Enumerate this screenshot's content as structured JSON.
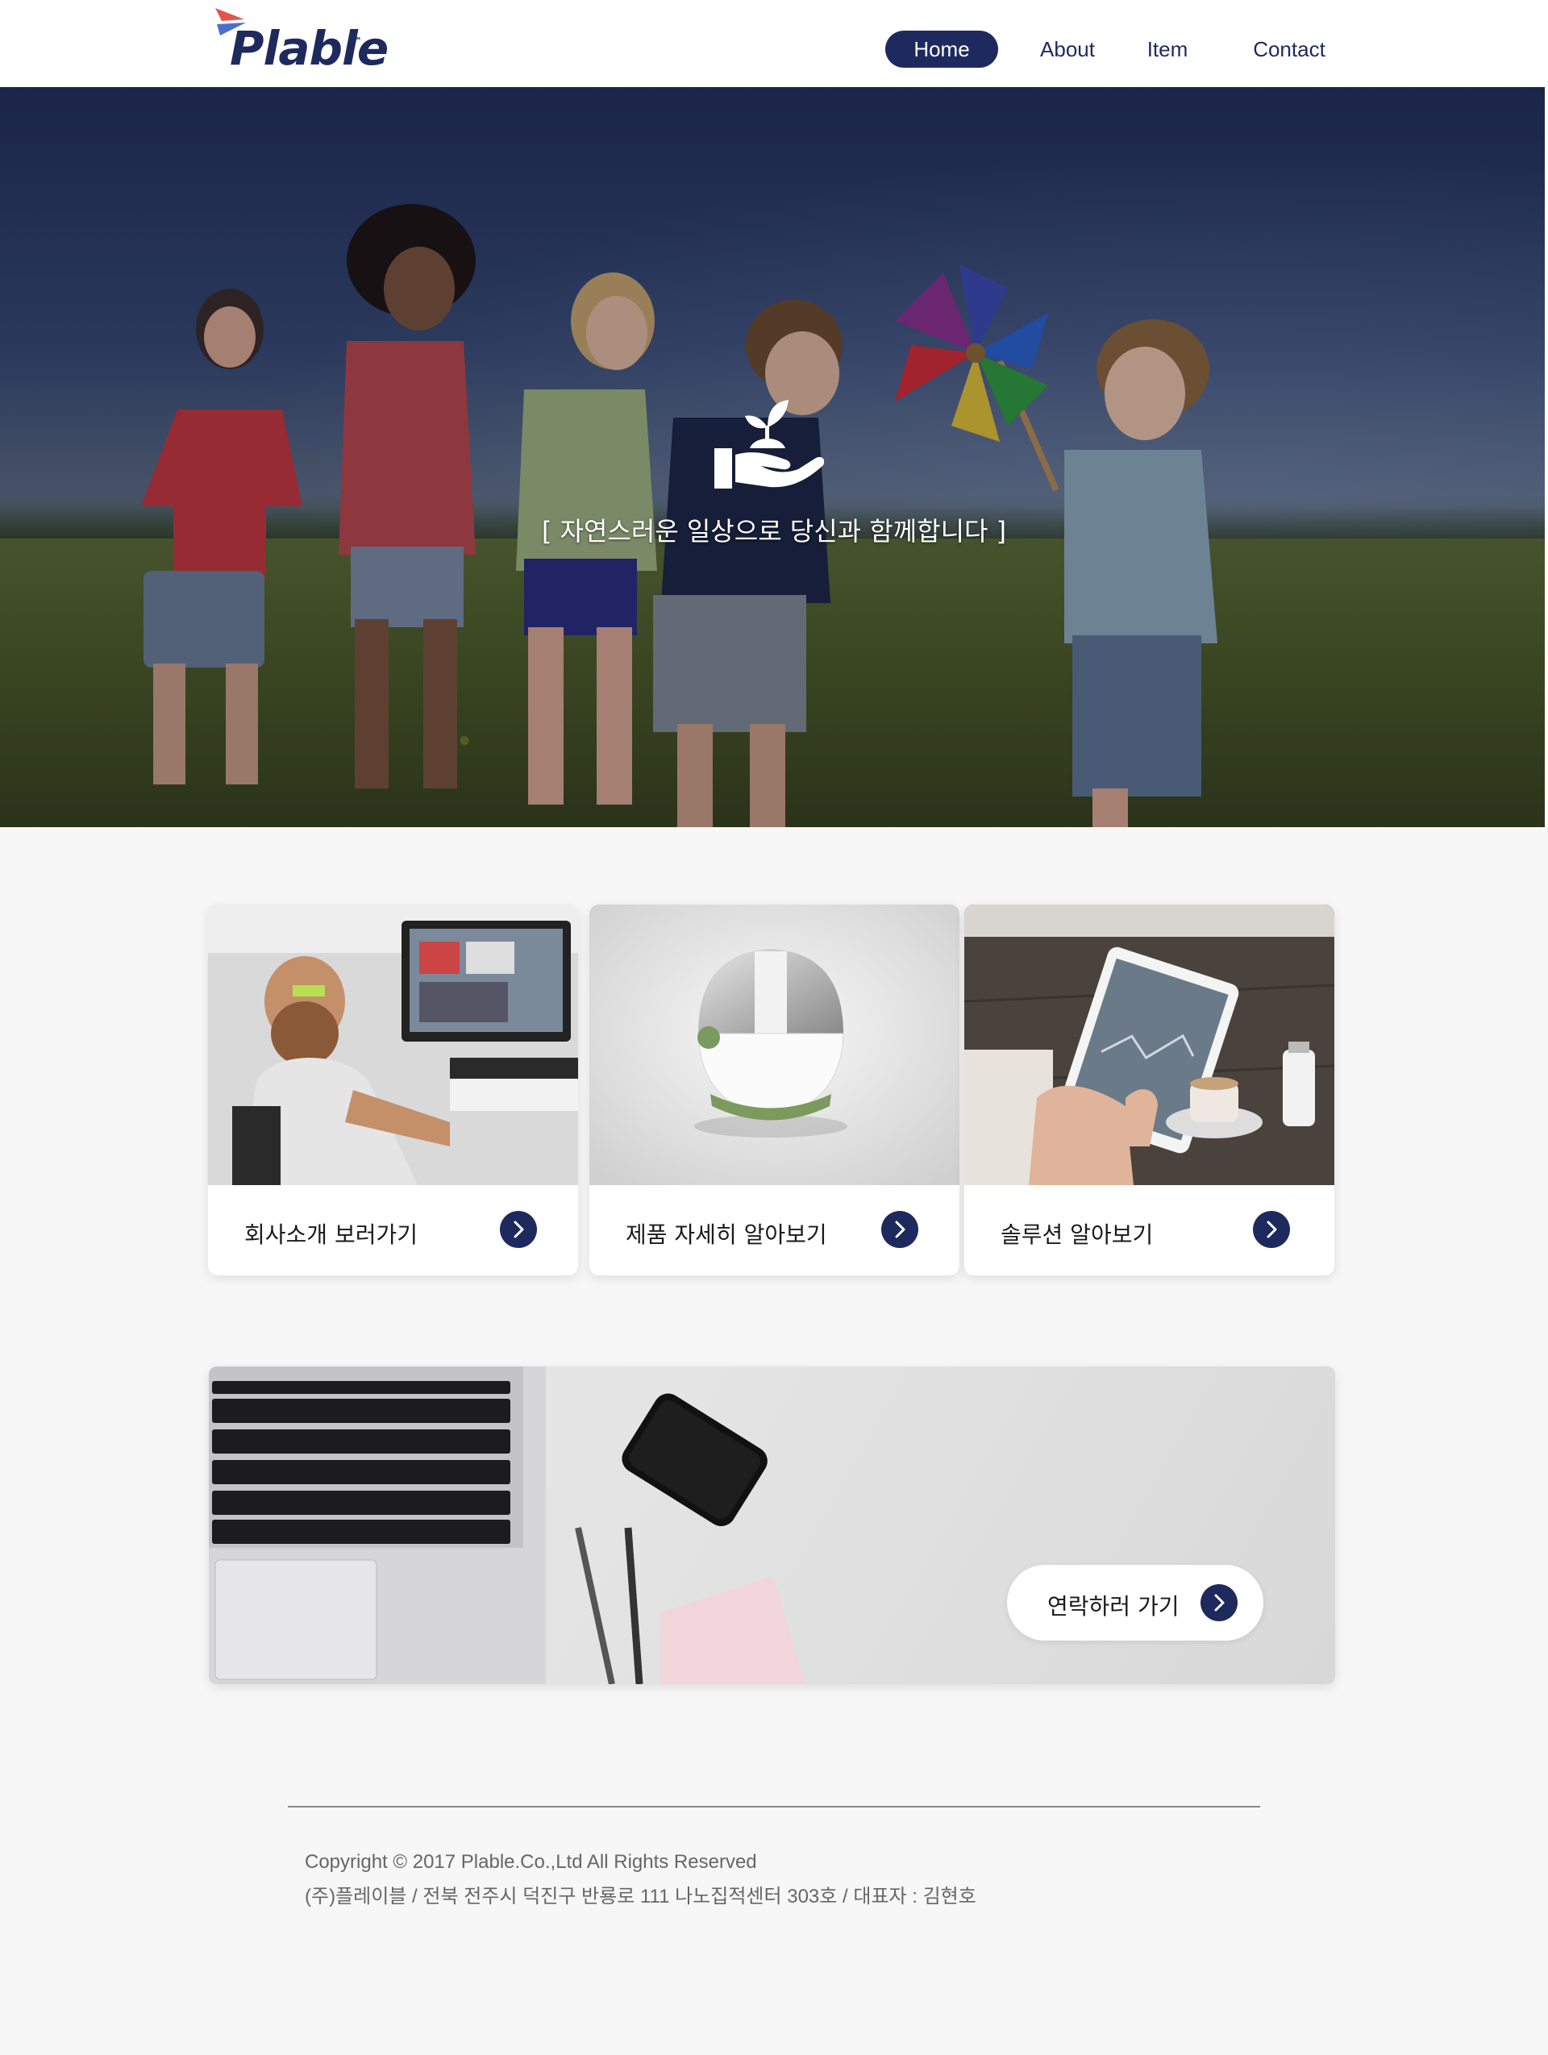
{
  "brand": {
    "logo_text": "Plable",
    "logo_tm": "™",
    "colors": {
      "navy": "#1e2a5e",
      "logo_red": "#e4554f",
      "logo_blue": "#4a6fd1"
    }
  },
  "nav": {
    "items": [
      {
        "label": "Home",
        "active": true
      },
      {
        "label": "About",
        "active": false
      },
      {
        "label": "Item",
        "active": false
      },
      {
        "label": "Contact",
        "active": false
      }
    ]
  },
  "hero": {
    "icon": "hand-sprout-icon",
    "tagline": "[ 자연스러운 일상으로 당신과 함께합니다 ]"
  },
  "cards": [
    {
      "label": "회사소개 보러가기",
      "image": "office-man-photo",
      "icon": "chevron-right-icon"
    },
    {
      "label": "제품 자세히 알아보기",
      "image": "product-device-photo",
      "icon": "chevron-right-icon"
    },
    {
      "label": "솔루션 알아보기",
      "image": "tablet-cafe-photo",
      "icon": "chevron-right-icon"
    }
  ],
  "contact_banner": {
    "button_label": "연락하러 가기",
    "icon": "chevron-right-icon"
  },
  "footer": {
    "copyright": "Copyright © 2017 Plable.Co.,Ltd All Rights Reserved",
    "address": "(주)플레이블 / 전북 전주시 덕진구 반룡로 111 나노집적센터 303호 / 대표자 : 김현호"
  }
}
